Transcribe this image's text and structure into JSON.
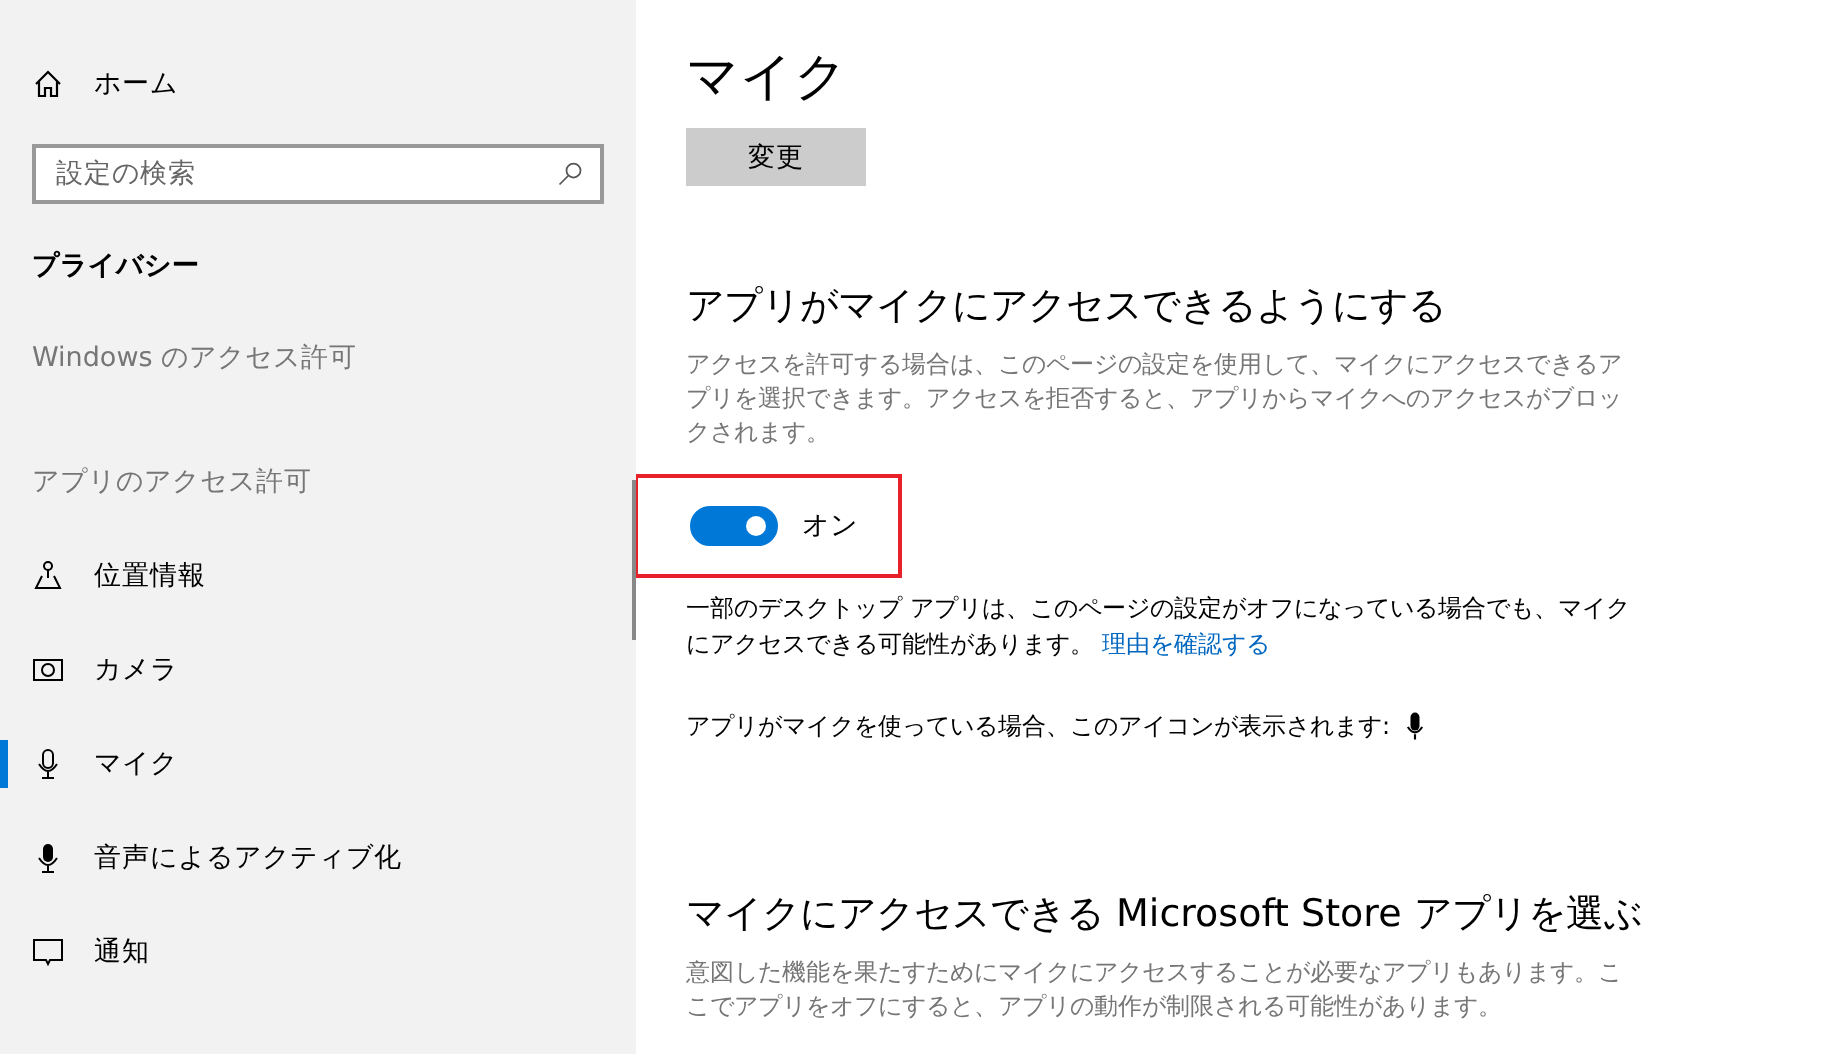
{
  "sidebar": {
    "home": {
      "label": "ホーム"
    },
    "search": {
      "placeholder": "設定の検索"
    },
    "section_title": "プライバシー",
    "groups": [
      {
        "title": "Windows のアクセス許可"
      },
      {
        "title": "アプリのアクセス許可",
        "items": [
          {
            "kind": "location",
            "label": "位置情報",
            "selected": false
          },
          {
            "kind": "camera",
            "label": "カメラ",
            "selected": false
          },
          {
            "kind": "mic",
            "label": "マイク",
            "selected": true
          },
          {
            "kind": "voice",
            "label": "音声によるアクティブ化",
            "selected": false
          },
          {
            "kind": "notify",
            "label": "通知",
            "selected": false
          }
        ]
      }
    ]
  },
  "main": {
    "title": "マイク",
    "change_button": "変更",
    "access_section": {
      "heading": "アプリがマイクにアクセスできるようにする",
      "description": "アクセスを許可する場合は、このページの設定を使用して、マイクにアクセスできるアプリを選択できます。アクセスを拒否すると、アプリからマイクへのアクセスがブロックされます。",
      "toggle": {
        "on": true,
        "label": "オン",
        "highlighted": true
      },
      "note": "一部のデスクトップ アプリは、このページの設定がオフになっている場合でも、マイクにアクセスできる可能性があります。",
      "note_link": "理由を確認する",
      "icon_note": "アプリがマイクを使っている場合、このアイコンが表示されます:"
    },
    "store_section": {
      "heading": "マイクにアクセスできる Microsoft Store アプリを選ぶ",
      "description": "意図した機能を果たすためにマイクにアクセスすることが必要なアプリもあります。ここでアプリをオフにすると、アプリの動作が制限される可能性があります。"
    }
  }
}
